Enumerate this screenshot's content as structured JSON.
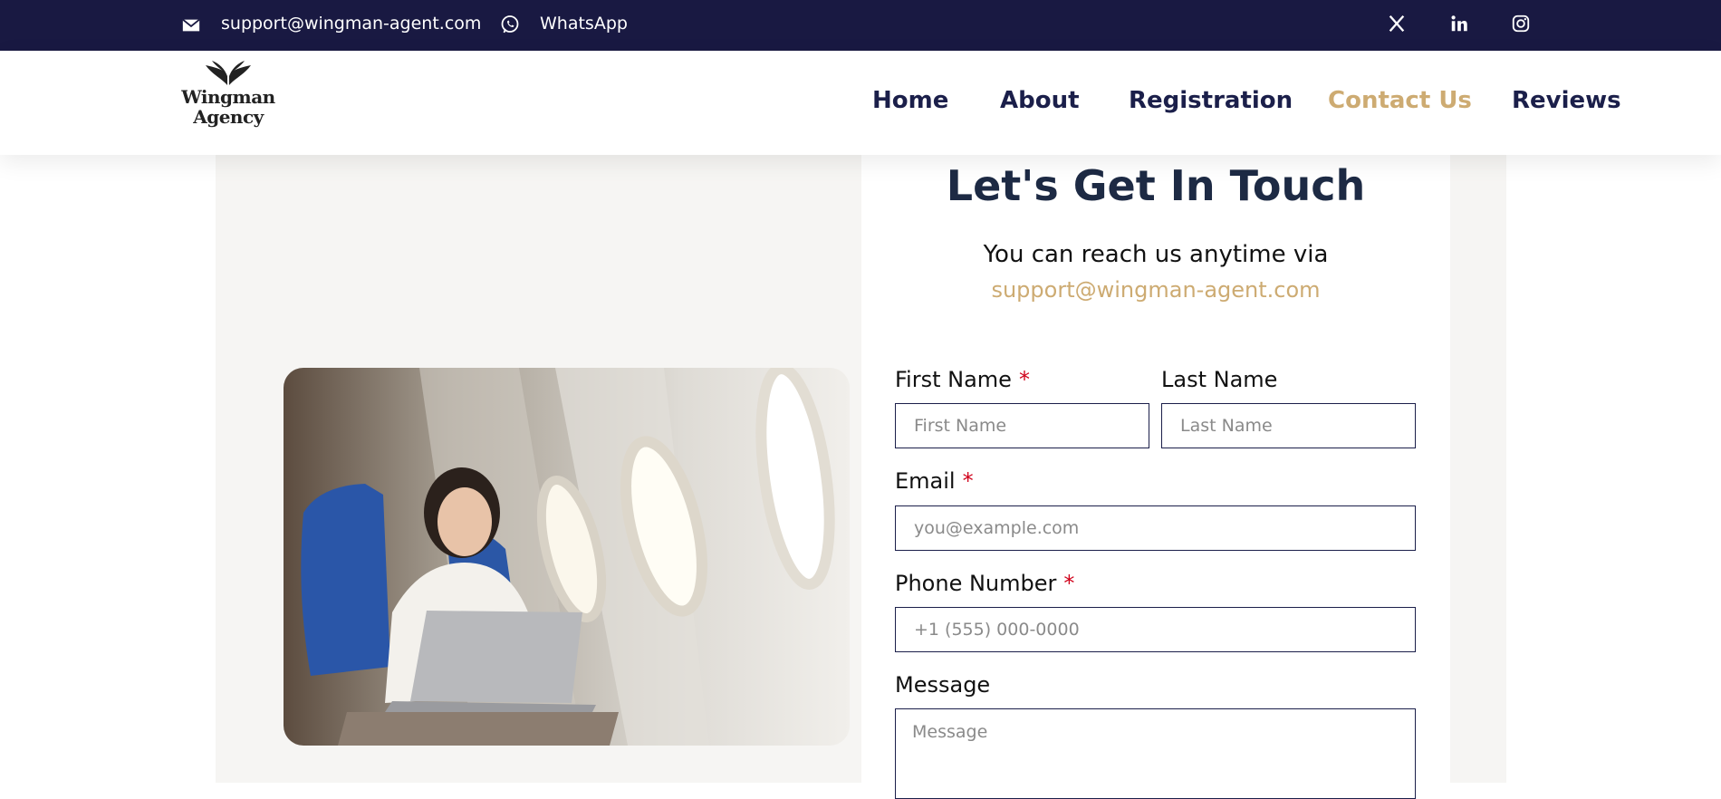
{
  "topbar": {
    "email": "support@wingman-agent.com",
    "whatsapp": "WhatsApp",
    "social": [
      "x-icon",
      "linkedin-icon",
      "instagram-icon"
    ]
  },
  "logo": {
    "line1": "Wingman",
    "line2": "Agency"
  },
  "nav": {
    "items": [
      "Home",
      "About",
      "Registration",
      "Contact Us",
      "Reviews"
    ],
    "active": "Contact Us"
  },
  "contact": {
    "title": "Let's Get In Touch",
    "subtitle": "You can reach us anytime via",
    "email": "support@wingman-agent.com"
  },
  "form": {
    "first_name_label": "First Name",
    "first_name_placeholder": "First Name",
    "last_name_label": "Last Name",
    "last_name_placeholder": "Last Name",
    "email_label": "Email",
    "email_placeholder": "you@example.com",
    "phone_label": "Phone Number",
    "phone_placeholder": "+1 (555) 000-0000",
    "message_label": "Message",
    "message_placeholder": "Message",
    "required_mark": "*"
  },
  "colors": {
    "topbar": "#191942",
    "nav_text": "#1b1f4a",
    "accent": "#cdab72",
    "required": "#d0021b"
  }
}
